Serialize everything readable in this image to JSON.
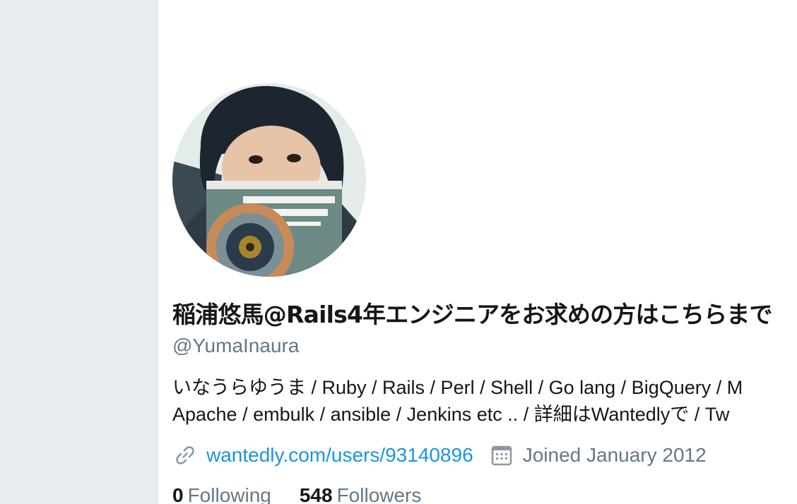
{
  "colors": {
    "sidebar_bg": "#e6ecf0",
    "link": "#1b95e0",
    "muted": "#657786",
    "text": "#14171a"
  },
  "profile": {
    "avatar_icon": "profile-photo",
    "display_name": "稲浦悠馬@Rails4年エンジニアをお求めの方はこちらまで",
    "handle": "@YumaInaura",
    "bio_lines": [
      "いなうらゆうま / Ruby / Rails / Perl / Shell / Go lang / BigQuery / M",
      "Apache / embulk / ansible / Jenkins etc .. / 詳細はWantedlyで / Tw"
    ],
    "website_icon": "link-icon",
    "website": "wantedly.com/users/93140896",
    "joined_icon": "calendar-icon",
    "joined": "Joined January 2012",
    "stats": [
      {
        "count": "0",
        "label": "Following"
      },
      {
        "count": "548",
        "label": "Followers"
      }
    ]
  }
}
